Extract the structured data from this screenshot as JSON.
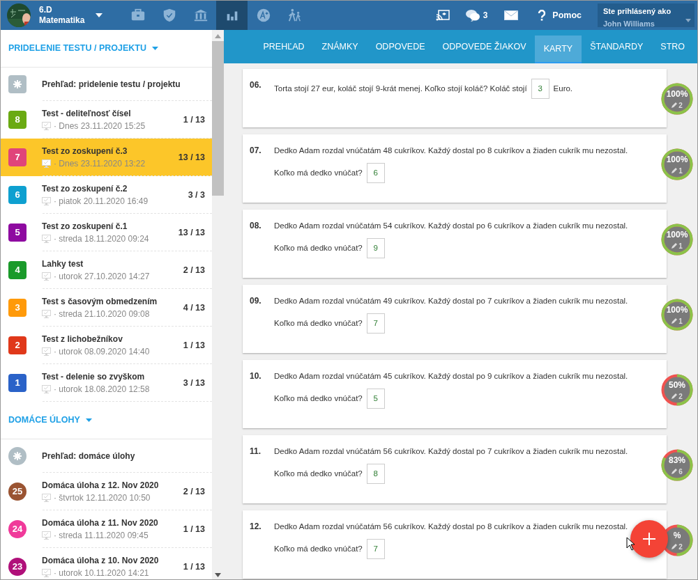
{
  "navbar": {
    "class_name": "6.D",
    "subject": "Matematika",
    "sections": [
      {
        "selected": false
      },
      {
        "selected": false
      },
      {
        "selected": false
      },
      {
        "selected": true
      },
      {
        "selected": false
      },
      {
        "selected": false
      }
    ],
    "chat_count": "3",
    "help": "Pomoc",
    "user_label": "Ste prihlásený ako",
    "user_name": "John Williams"
  },
  "sidebar": {
    "sections": [
      {
        "title": "PRIDELENIE TESTU / PROJEKTU",
        "kind": "tests",
        "items": [
          {
            "kind": "overview",
            "title": "Prehľad: pridelenie testu / projektu",
            "selected": false
          },
          {
            "kind": "entry",
            "number": "8",
            "color": "#6aaa12",
            "title": "Test - deliteľnosť čísel",
            "date": "· Dnes 23.11.2020 15:25",
            "score": "1 / 13",
            "selected": false
          },
          {
            "kind": "entry",
            "number": "7",
            "color": "#e0447a",
            "title": "Test zo zoskupení č.3",
            "date": "· Dnes 23.11.2020 13:22",
            "score": "13 / 13",
            "selected": true
          },
          {
            "kind": "entry",
            "number": "6",
            "color": "#0ea0d0",
            "title": "Test zo zoskupení č.2",
            "date": "· piatok 20.11.2020 16:49",
            "score": "3 / 3",
            "selected": false
          },
          {
            "kind": "entry",
            "number": "5",
            "color": "#8e0aa0",
            "title": "Test zo zoskupení č.1",
            "date": "· streda 18.11.2020 09:24",
            "score": "13 / 13",
            "selected": false
          },
          {
            "kind": "entry",
            "number": "4",
            "color": "#1a9a2a",
            "title": "Lahky test",
            "date": "· utorok 27.10.2020 14:27",
            "score": "2 / 13",
            "selected": false
          },
          {
            "kind": "entry",
            "number": "3",
            "color": "#ff9a0a",
            "title": "Test s časovým obmedzením",
            "date": "· streda 21.10.2020 09:08",
            "score": "4 / 13",
            "selected": false
          },
          {
            "kind": "entry",
            "number": "2",
            "color": "#e0381a",
            "title": "Test z lichobežníkov",
            "date": "· utorok 08.09.2020 14:40",
            "score": "1 / 13",
            "selected": false
          },
          {
            "kind": "entry",
            "number": "1",
            "color": "#2a62c8",
            "title": "Test - delenie so zvyškom",
            "date": "· utorok 18.08.2020 12:58",
            "score": "3 / 13",
            "selected": false
          }
        ]
      },
      {
        "title": "DOMÁCE ÚLOHY",
        "kind": "homework",
        "items": [
          {
            "kind": "overview",
            "title": "Prehľad: domáce úlohy",
            "selected": false
          },
          {
            "kind": "entry",
            "number": "25",
            "color": "#9a5432",
            "title": "Domáca úloha z 12. Nov 2020",
            "date": "· štvrtok 12.11.2020 10:50",
            "score": "2 / 13",
            "selected": false
          },
          {
            "kind": "entry",
            "number": "24",
            "color": "#f03a9a",
            "title": "Domáca úloha z 11. Nov 2020",
            "date": "· streda 11.11.2020 09:45",
            "score": "1 / 13",
            "selected": false
          },
          {
            "kind": "entry",
            "number": "23",
            "color": "#b0107a",
            "title": "Domáca úloha z 10. Nov 2020",
            "date": "· utorok 10.11.2020 14:21",
            "score": "1 / 13",
            "selected": false
          }
        ]
      }
    ]
  },
  "tabs": [
    {
      "label": "PREHĽAD",
      "selected": false
    },
    {
      "label": "ZNÁMKY",
      "selected": false
    },
    {
      "label": "ODPOVEDE",
      "selected": false
    },
    {
      "label": "ODPOVEDE ŽIAKOV",
      "selected": false
    },
    {
      "label": "KARTY",
      "selected": true
    },
    {
      "label": "ŠTANDARDY",
      "selected": false
    },
    {
      "label": "STRO",
      "selected": false
    }
  ],
  "questions": [
    {
      "number": "06.",
      "lines": [
        [
          {
            "kind": "text",
            "text": "Torta stojí 27 eur, koláč stojí 9-krát menej. Koľko stojí koláč? Koláč stojí"
          },
          {
            "kind": "answer",
            "value": "3"
          },
          {
            "kind": "text",
            "text": "Euro."
          }
        ]
      ],
      "score": {
        "percent": "100%",
        "count": "2",
        "level": 1
      }
    },
    {
      "number": "07.",
      "lines": [
        [
          {
            "kind": "text",
            "text": "Dedko Adam rozdal vnúčatám 48 cukríkov. Každý dostal po 8 cukríkov a žiaden cukrík mu nezostal."
          }
        ],
        [
          {
            "kind": "text",
            "text": "Koľko má dedko vnúčat?"
          },
          {
            "kind": "answer",
            "value": "6"
          }
        ]
      ],
      "score": {
        "percent": "100%",
        "count": "1",
        "level": 1
      }
    },
    {
      "number": "08.",
      "lines": [
        [
          {
            "kind": "text",
            "text": "Dedko Adam rozdal vnúčatám 54 cukríkov. Každý dostal po 6 cukríkov a žiaden cukrík mu nezostal."
          }
        ],
        [
          {
            "kind": "text",
            "text": "Koľko má dedko vnúčat?"
          },
          {
            "kind": "answer",
            "value": "9"
          }
        ]
      ],
      "score": {
        "percent": "100%",
        "count": "1",
        "level": 1
      }
    },
    {
      "number": "09.",
      "lines": [
        [
          {
            "kind": "text",
            "text": "Dedko Adam rozdal vnúčatám 49 cukríkov. Každý dostal po 7 cukríkov a žiaden cukrík mu nezostal."
          }
        ],
        [
          {
            "kind": "text",
            "text": "Koľko má dedko vnúčat?"
          },
          {
            "kind": "answer",
            "value": "7"
          }
        ]
      ],
      "score": {
        "percent": "100%",
        "count": "1",
        "level": 1
      }
    },
    {
      "number": "10.",
      "lines": [
        [
          {
            "kind": "text",
            "text": "Dedko Adam rozdal vnúčatám 45 cukríkov. Každý dostal po 9 cukríkov a žiaden cukrík mu nezostal."
          }
        ],
        [
          {
            "kind": "text",
            "text": "Koľko má dedko vnúčat?"
          },
          {
            "kind": "answer",
            "value": "5"
          }
        ]
      ],
      "score": {
        "percent": "50%",
        "count": "2",
        "level": 0.5
      }
    },
    {
      "number": "11.",
      "lines": [
        [
          {
            "kind": "text",
            "text": "Dedko Adam rozdal vnúčatám 56 cukríkov. Každý dostal po 7 cukríkov a žiaden cukrík mu nezostal."
          }
        ],
        [
          {
            "kind": "text",
            "text": "Koľko má dedko vnúčat?"
          },
          {
            "kind": "answer",
            "value": "8"
          }
        ]
      ],
      "score": {
        "percent": "83%",
        "count": "6",
        "level": 0.83
      }
    },
    {
      "number": "12.",
      "lines": [
        [
          {
            "kind": "text",
            "text": "Dedko Adam rozdal vnúčatám 56 cukríkov. Každý dostal po 8 cukríkov a žiaden cukrík mu nezostal."
          }
        ],
        [
          {
            "kind": "text",
            "text": "Koľko má dedko vnúčat?"
          },
          {
            "kind": "answer",
            "value": "7"
          }
        ]
      ],
      "score": {
        "percent": "%",
        "count": "2",
        "level": 0.5
      }
    }
  ]
}
